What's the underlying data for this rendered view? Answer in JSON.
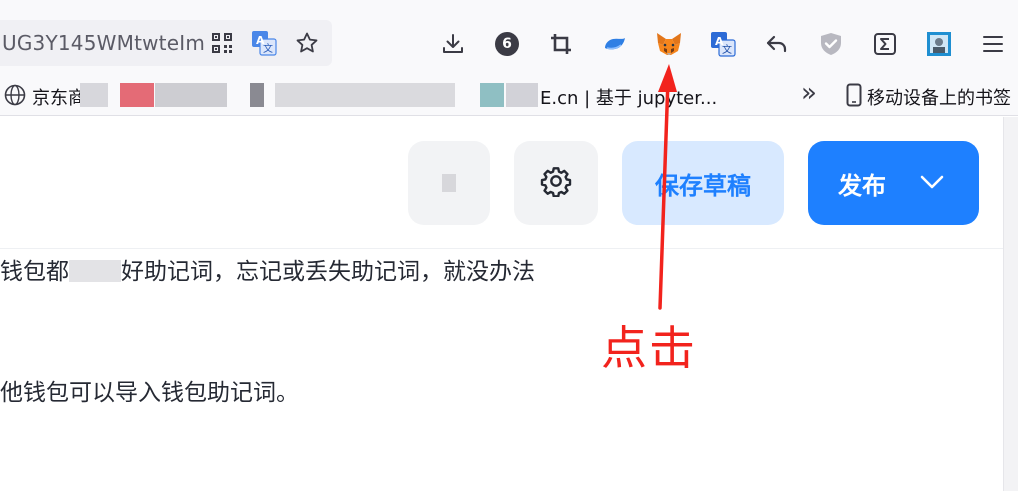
{
  "browser": {
    "url_text": "UG3Y145WMtwteIm",
    "bookmarks": {
      "item1": "京东商",
      "item2": "E.cn | 基于 jupyter...",
      "overflow": "»",
      "mobile": "移动设备上的书签"
    },
    "extension_badge_count": "6"
  },
  "editor": {
    "draft_label": "保存草稿",
    "publish_label": "发布",
    "paragraph_1a": "钱包都",
    "paragraph_1b": "好助记词，忘记或丢失助记词，就没办法",
    "paragraph_2": "他钱包可以导入钱包助记词。"
  },
  "annotation": {
    "label": "点击",
    "color": "#f2231d"
  },
  "colors": {
    "accent": "#1e80ff",
    "draft_bg": "#d8e9ff"
  }
}
